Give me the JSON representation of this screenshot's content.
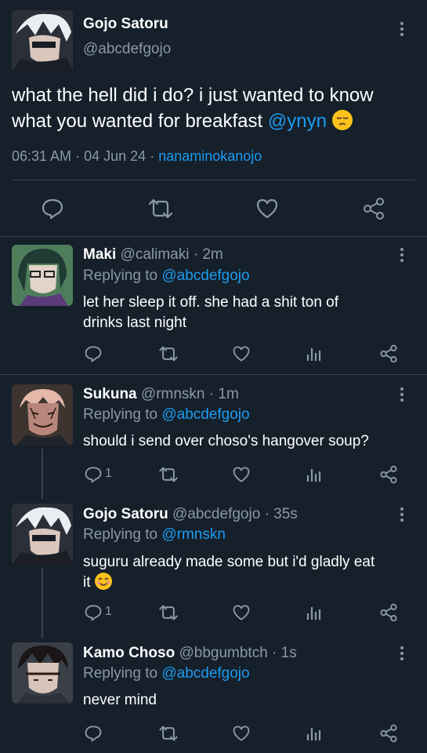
{
  "main_tweet": {
    "name": "Gojo Satoru",
    "handle": "@abcdefgojo",
    "text_line1": "what the hell did i do? i just wanted to know",
    "text_line2": "what you wanted for breakfast",
    "mention": "@ynyn",
    "time": "06:31 AM",
    "date": "04 Jun 24",
    "client": "nanaminokanojo",
    "sep": "·"
  },
  "replies": [
    {
      "name": "Maki",
      "handle": "@calimaki",
      "age": "2m",
      "replying_label": "Replying to",
      "replying_to": "@abcdefgojo",
      "line1": "let her sleep it off. she had a shit ton of",
      "line2": "drinks last night"
    },
    {
      "name": "Sukuna",
      "handle": "@rmnskn",
      "age": "1m",
      "replying_label": "Replying to",
      "replying_to": "@abcdefgojo",
      "line1": "should i send over choso's hangover soup?",
      "reply_count": "1"
    },
    {
      "name": "Gojo Satoru",
      "handle": "@abcdefgojo",
      "age": "35s",
      "replying_label": "Replying to",
      "replying_to": "@rmnskn",
      "line1": "suguru already made some but i'd gladly eat",
      "line2": "it",
      "reply_count": "1"
    },
    {
      "name": "Kamo Choso",
      "handle": "@bbgumbtch",
      "age": "1s",
      "replying_label": "Replying to",
      "replying_to": "@abcdefgojo",
      "line1": "never mind"
    }
  ],
  "colors": {
    "background": "#15202b",
    "accent": "#1d9bf0",
    "muted": "#8b98a5",
    "divider": "#38444d"
  }
}
